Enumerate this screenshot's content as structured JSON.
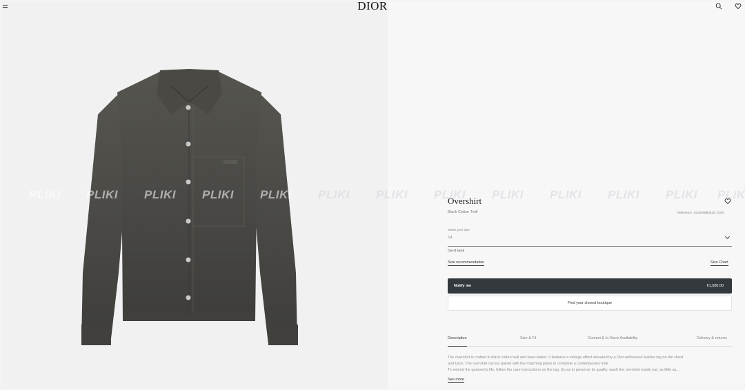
{
  "header": {
    "logo": "DIOR",
    "icons": [
      "menu-icon",
      "search-icon",
      "heart-icon"
    ]
  },
  "watermark": [
    "PLIKI",
    "PLIKI",
    "PLIKI",
    "PLIKI",
    "PLIKI",
    "PLIKI",
    "PLIKI",
    "PLIKI",
    "PLIKI",
    "PLIKI",
    "PLIKI",
    "PLIKI",
    "PLIKI"
  ],
  "product": {
    "title": "Overshirt",
    "subtitle": "Black Cotton Twill",
    "reference": "Reference: 413D488B3519_C830",
    "size_label": "Select your size",
    "size_value": "S4",
    "stock_status": "Out of stock",
    "size_recommendation": "Size recommendation",
    "size_chart": "Size Chart",
    "notify_label": "Notify me",
    "price": "€1,500.00",
    "boutique_label": "Find your closest boutique"
  },
  "tabs": [
    "Description",
    "Size & Fit",
    "Contact & In-Store Availability",
    "Delivery & returns"
  ],
  "description": {
    "line1": "The overshirt is crafted in black cotton twill and laser-faded. It features a vintage effect elevated by a Dior-embossed leather tag on the chest",
    "line2": "and back. The overshirt can be paired with the matching jeans to complete a contemporary look.",
    "line3": "To extend the garment's life, follow the care instructions on the tag. So as to preserve its quality, wash the overshirt inside out, as little as...",
    "see_more": "See more"
  },
  "colors": {
    "button_dark": "#33383c",
    "jacket": "#4a4a48"
  }
}
